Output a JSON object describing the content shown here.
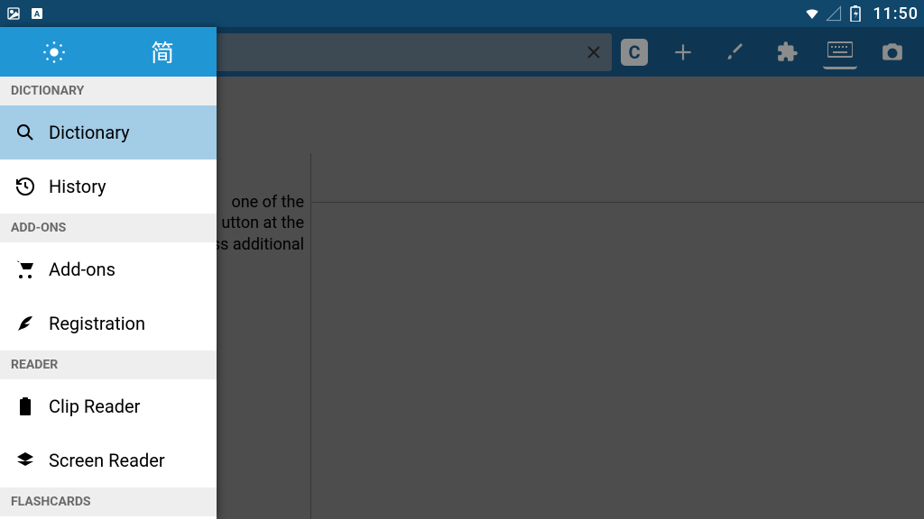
{
  "statusbar": {
    "time": "11:50"
  },
  "appbar": {
    "c_label": "C"
  },
  "drawer": {
    "lang_label": "简",
    "sections": {
      "dictionary_header": "DICTIONARY",
      "dictionary": "Dictionary",
      "history": "History",
      "addons_header": "ADD-ONS",
      "addons": "Add-ons",
      "registration": "Registration",
      "reader_header": "READER",
      "clip_reader": "Clip Reader",
      "screen_reader": "Screen Reader",
      "flashcards_header": "FLASHCARDS"
    }
  },
  "background": {
    "hint_text": "one of the\nutton at the\ness additional"
  }
}
